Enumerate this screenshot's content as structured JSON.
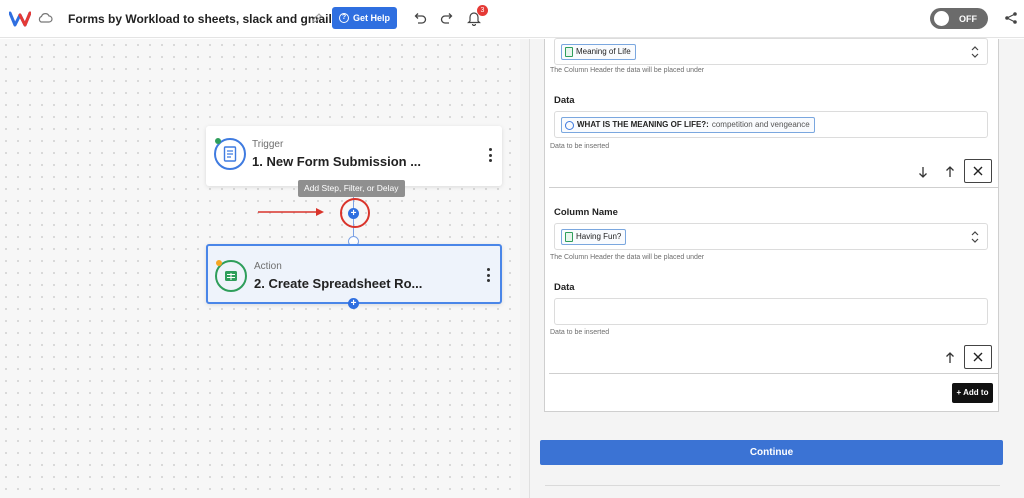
{
  "topbar": {
    "workflow_title": "Forms by Workload to sheets, slack and gmail",
    "help_label": "Get Help",
    "notification_count": "3",
    "toggle_label": "OFF",
    "brand_color": "#2f6fe0"
  },
  "canvas": {
    "trigger": {
      "kind": "Trigger",
      "name": "1. New Form Submission ..."
    },
    "action": {
      "kind": "Action",
      "name": "2. Create Spreadsheet Ro..."
    },
    "tooltip": "Add Step, Filter, or Delay",
    "plus_symbol": "+",
    "add_step_symbol": "+"
  },
  "panel": {
    "row1": {
      "column_chip": "Meaning of Life",
      "column_hint": "The Column Header the data will be placed under",
      "data_label": "Data",
      "data_chip_question": "WHAT IS THE MEANING OF LIFE?:",
      "data_chip_answer": "competition and vengeance",
      "data_hint": "Data to be inserted"
    },
    "row2": {
      "column_label": "Column Name",
      "column_chip": "Having Fun?",
      "column_hint": "The Column Header the data will be placed under",
      "data_label": "Data",
      "data_value": "",
      "data_hint": "Data to be inserted"
    },
    "remove_symbol": "✕",
    "add_to_label": "+ Add to",
    "continue_label": "Continue"
  }
}
